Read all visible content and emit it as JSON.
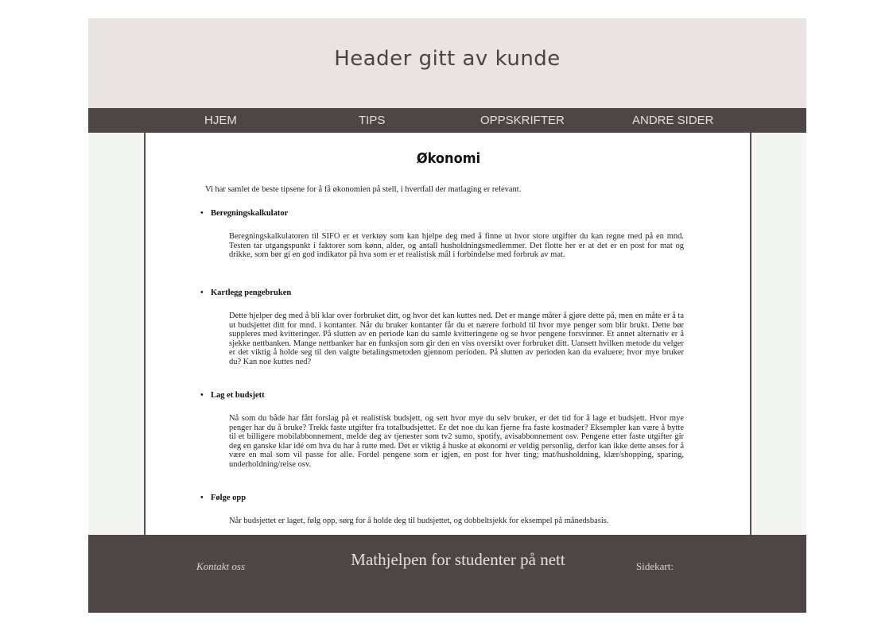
{
  "header": {
    "title": "Header gitt av kunde"
  },
  "nav": {
    "items": [
      {
        "label": "HJEM"
      },
      {
        "label": "TIPS"
      },
      {
        "label": "OPPSKRIFTER"
      },
      {
        "label": "ANDRE SIDER"
      }
    ]
  },
  "main": {
    "title": "Økonomi",
    "intro": "Vi har samlet de beste tipsene for å få økonomien på stell, i hvertfall der matlaging er relevant.",
    "sections": [
      {
        "heading": "Beregningskalkulator",
        "body": "Beregningskalkulatoren til SIFO er et verktøy som kan hjelpe deg med å finne ut hvor store utgifter du kan regne med på en mnd. Testen tar utgangspunkt i faktorer som kønn, alder, og antall husholdningsmedlemmer. Det flotte her er at det er en post for mat og drikke, som bør gi en god indikator på hva som er et realistisk mål i forbindelse med forbruk av mat."
      },
      {
        "heading": "Kartlegg pengebruken",
        "body": "Dette hjelper deg med å bli klar over forbruket ditt, og hvor det kan kuttes ned. Det er mange måter å gjøre dette på, men en måte er å ta ut budsjettet ditt for mnd. i kontanter. Når du bruker kontanter får du et nærere forhold til hvor mye penger som blir brukt. Dette bør suppleres med kvitteringer. På slutten av en periode kan du samle kvitteringene og se hvor pengene forsvinner. Et annet alternativ er å sjekke nettbanken. Mange nettbanker har en funksjon som gir den en viss oversikt over forbruket ditt. Uansett hvilken metode du velger er det viktig å holde seg til den valgte betalingsmetoden gjennom perioden. På slutten av perioden kan du evaluere; hvor mye bruker du? Kan noe kuttes ned?"
      },
      {
        "heading": "Lag et budsjett",
        "body": "Nå som du både har fått forslag på et realistisk budsjett, og sett hvor mye du selv bruker, er det tid for å lage et budsjett. Hvor mye penger har du å bruke? Trekk faste utgifter fra totalbudsjettet. Er det noe du kan fjerne fra faste kostnader? Eksempler kan være å bytte til et billigere mobilabbonnement, melde deg av tjenester som tv2 sumo, spotify, avisabbonnement osv. Pengene etter faste utgifter gir deg en ganske klar idé om hva du har å rutte med. Det er viktig å huske at økonomi er veldig personlig, derfor kan ikke dette anses for å være en mal som vil passe for alle. Fordel pengene som er igjen, en post for hver ting; mat/husholdning, klær/shopping, sparing, underholdning/reise osv."
      },
      {
        "heading": "Følge opp",
        "body": "Når budsjettet er laget, følg opp, sørg for å holde deg til budsjettet, og dobbeltsjekk for eksempel på månedsbasis."
      }
    ]
  },
  "footer": {
    "contact": "Kontakt oss",
    "title": "Mathjelpen for studenter på nett",
    "sitemap": "Sidekart:"
  },
  "colors": {
    "header_bg": "#e9e3e1",
    "nav_bg": "#4e4644",
    "side_bg": "#f3f6f2",
    "footer_bg": "#4e4644"
  }
}
